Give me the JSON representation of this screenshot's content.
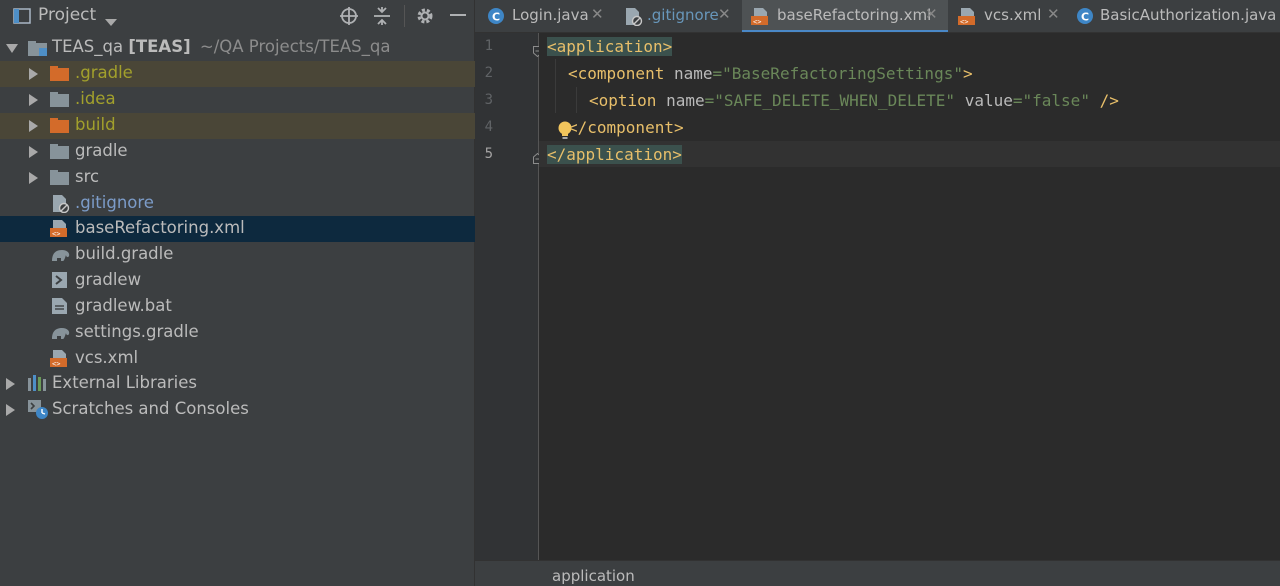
{
  "project_panel": {
    "title": "Project",
    "root": {
      "name": "TEAS_qa",
      "module": "[TEAS]",
      "path": "~/QA Projects/TEAS_qa"
    },
    "items": [
      {
        "label": ".gradle",
        "kind": "folder",
        "status": "ignored"
      },
      {
        "label": ".idea",
        "kind": "folder",
        "status": "ignored"
      },
      {
        "label": "build",
        "kind": "folder",
        "status": "ignored"
      },
      {
        "label": "gradle",
        "kind": "folder",
        "status": "normal"
      },
      {
        "label": "src",
        "kind": "folder",
        "status": "normal"
      },
      {
        "label": ".gitignore",
        "kind": "gitignore-file",
        "status": "unversioned"
      },
      {
        "label": "baseRefactoring.xml",
        "kind": "xml-file",
        "status": "selected"
      },
      {
        "label": "build.gradle",
        "kind": "gradle-file",
        "status": "normal"
      },
      {
        "label": "gradlew",
        "kind": "shell-file",
        "status": "normal"
      },
      {
        "label": "gradlew.bat",
        "kind": "text-file",
        "status": "normal"
      },
      {
        "label": "settings.gradle",
        "kind": "gradle-file",
        "status": "normal"
      },
      {
        "label": "vcs.xml",
        "kind": "xml-file",
        "status": "normal"
      }
    ],
    "extra_nodes": [
      {
        "label": "External Libraries",
        "icon": "libraries-icon"
      },
      {
        "label": "Scratches and Consoles",
        "icon": "scratches-icon"
      }
    ]
  },
  "editor": {
    "tabs": [
      {
        "label": "Login.java",
        "icon": "java-class-icon",
        "active": false
      },
      {
        "label": ".gitignore",
        "icon": "gitignore-file-icon",
        "active": false
      },
      {
        "label": "baseRefactoring.xml",
        "icon": "xml-file-icon",
        "active": true
      },
      {
        "label": "vcs.xml",
        "icon": "xml-file-icon",
        "active": false
      },
      {
        "label": "BasicAuthorization.java",
        "icon": "java-class-icon",
        "active": false
      }
    ],
    "line_numbers": [
      "1",
      "2",
      "3",
      "4",
      "5"
    ],
    "current_line": "5",
    "code": {
      "l1_tag": "<application>",
      "l2_open": "<component ",
      "l2_attr": "name",
      "l2_eq": "=",
      "l2_val": "\"BaseRefactoringSettings\"",
      "l2_close": ">",
      "l3_open": "<option ",
      "l3_attr1": "name",
      "l3_eq1": "=",
      "l3_val1": "\"SAFE_DELETE_WHEN_DELETE\"",
      "l3_attr2": "value",
      "l3_eq2": "=",
      "l3_val2": "\"false\"",
      "l3_close": "/>",
      "l4_tag": "</component>",
      "l5_tag": "</application>"
    },
    "breadcrumb": "application"
  },
  "colors": {
    "tag": "#e8bf6a",
    "attribute": "#bababa",
    "string": "#6a8759",
    "ignored_text": "#a2a02c",
    "selection": "#0d293e",
    "active_tab_underline": "#4a88c7"
  }
}
